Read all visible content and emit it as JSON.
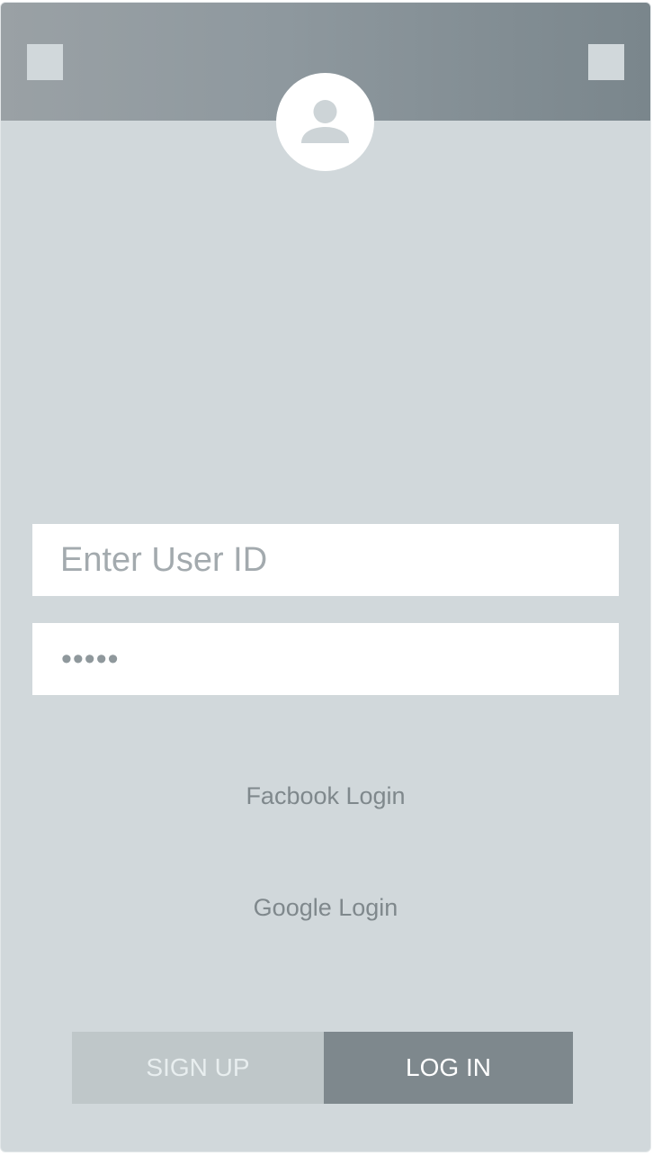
{
  "header": {
    "left_button_icon": "square-icon",
    "right_button_icon": "square-icon",
    "avatar_icon": "user-avatar-icon"
  },
  "login_form": {
    "userid_placeholder": "Enter User ID",
    "userid_value": "",
    "password_display": "•••••"
  },
  "social": {
    "facebook_label": "Facbook Login",
    "google_label": "Google Login"
  },
  "actions": {
    "signup_label": "SIGN UP",
    "login_label": "LOG IN"
  },
  "colors": {
    "background": "#d1d8db",
    "header_gradient_start": "#9aa1a5",
    "header_gradient_end": "#7a868c",
    "signup_bg": "#bfc7c9",
    "login_bg": "#7e888d"
  }
}
